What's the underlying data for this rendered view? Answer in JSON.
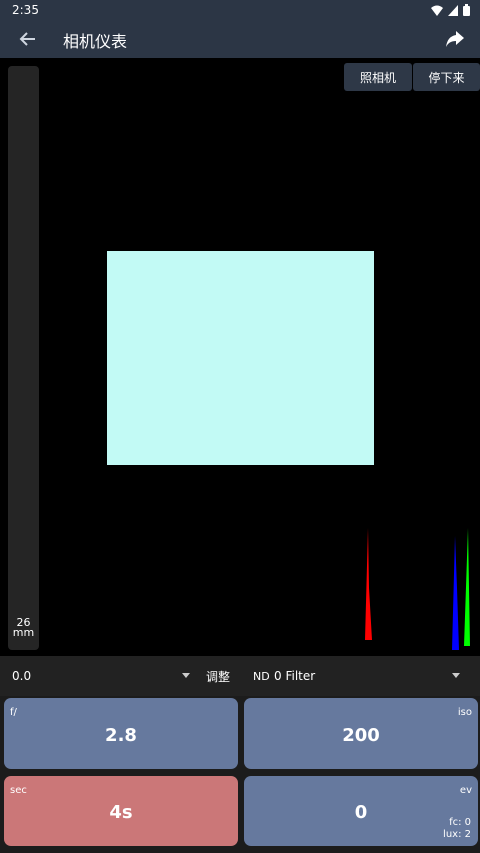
{
  "status": {
    "time": "2:35"
  },
  "app_bar": {
    "title": "相机仪表"
  },
  "viewfinder": {
    "zoom_value": "26",
    "zoom_unit": "mm",
    "photo_button": "照相机",
    "stop_button": "停下来"
  },
  "controls": {
    "ec_value": "0.0",
    "adjust_label": "调整",
    "nd_label": "ND",
    "nd_value": "0 Filter"
  },
  "cards": {
    "aperture": {
      "label": "f/",
      "value": "2.8"
    },
    "iso": {
      "label": "iso",
      "value": "200"
    },
    "shutter": {
      "label": "sec",
      "value": "4s"
    },
    "ev": {
      "label": "ev",
      "value": "0",
      "fc": "fc: 0",
      "lux": "lux: 2"
    }
  },
  "colors": {
    "app_bar": "#2c3645",
    "meter_area": "#c2faf5",
    "card_blue": "#66799e",
    "card_red": "#cb7778",
    "histogram_red": "#ff0000",
    "histogram_green": "#00ff00",
    "histogram_blue": "#0000ff"
  }
}
